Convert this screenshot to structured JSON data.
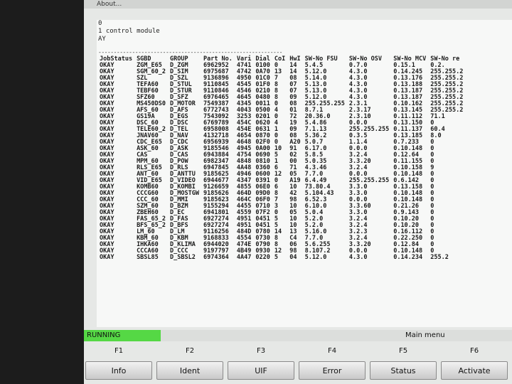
{
  "window": {
    "title": "About..."
  },
  "header": {
    "lines": [
      "0",
      "1 control module",
      "AY"
    ]
  },
  "separator": "------------------------------------------------------------",
  "table": {
    "columns": [
      "JobStatus",
      "SGBD",
      "GROUP",
      "Part No.",
      "Vari",
      "Dial",
      "CoI",
      "HwI",
      "SW-No FSU",
      "SW-No OSV",
      "SW-No MCV",
      "SW-No re"
    ],
    "rows": [
      [
        "OKAY",
        "ZGM_E65",
        "D_ZGM",
        "6962952",
        "4741",
        "0100",
        "0",
        "14",
        "5.4.5",
        "0.7.0",
        "0.15.1",
        "0.2."
      ],
      [
        "OKAY",
        "SGM_60_2",
        "D_SIM",
        "6975687",
        "4742",
        "0A70",
        "13",
        "14",
        "5.12.0",
        "4.3.0",
        "0.14.245",
        "255.255.2"
      ],
      [
        "OKAY",
        "SZL",
        "D_SZL",
        "9136896",
        "4950",
        "01C0",
        "7",
        "08",
        "5.14.0",
        "4.3.0",
        "0.13.176",
        "255.255.2"
      ],
      [
        "OKAY",
        "TEFA60",
        "D_STUL",
        "9110845",
        "4545",
        "01F0",
        "8",
        "07",
        "5.13.0",
        "4.3.0",
        "0.13.188",
        "255.255.2"
      ],
      [
        "OKAY",
        "TEBF60",
        "D_STUR",
        "9110846",
        "4546",
        "0210",
        "8",
        "07",
        "5.13.0",
        "4.3.0",
        "0.13.187",
        "255.255.2"
      ],
      [
        "OKAY",
        "SFZ60",
        "D_SFZ",
        "6976465",
        "4645",
        "0480",
        "8",
        "09",
        "5.12.0",
        "4.3.0",
        "0.13.187",
        "255.255.2"
      ],
      [
        "OKAY",
        "MS450DS0",
        "D_MOTOR",
        "7549387",
        "4345",
        "0011",
        "0",
        "08",
        "255.255.255",
        "2.3.1",
        "0.10.162",
        "255.255.2"
      ],
      [
        "OKAY",
        "AFS_60",
        "D_AFS",
        "6772743",
        "4043",
        "0500",
        "4",
        "01",
        "8.7.1",
        "2.3.17",
        "0.13.145",
        "255.255.2"
      ],
      [
        "OKAY",
        "GS19A",
        "D_EGS",
        "7543092",
        "3253",
        "0201",
        "0",
        "72",
        "20.36.0",
        "2.3.10",
        "0.11.112",
        "71.1"
      ],
      [
        "OKAY",
        "DSC_60",
        "D_DSC",
        "6769789",
        "454C",
        "0620",
        "4",
        "19",
        "5.4.86",
        "0.0.0",
        "0.13.150",
        "0"
      ],
      [
        "OKAY",
        "TELE60_2",
        "D_TEL",
        "6958008",
        "454E",
        "0631",
        "1",
        "09",
        "7.1.13",
        "255.255.255",
        "0.11.137",
        "60.4"
      ],
      [
        "OKAY",
        "JNAV60",
        "D_NAV",
        "4132718",
        "4654",
        "0870",
        "0",
        "08",
        "5.36.2",
        "0.3.5",
        "0.13.185",
        "8.0"
      ],
      [
        "OKAY",
        "CDC_E65",
        "D_CDC",
        "6956939",
        "4648",
        "02F0",
        "0",
        "A20",
        "5.0.7",
        "1.1.4",
        "0.7.233",
        "0"
      ],
      [
        "OKAY",
        "ASK_60",
        "D_ASK",
        "9185546",
        "4945",
        "0A00",
        "10",
        "91",
        "6.17.0",
        "0.0.0",
        "0.10.148",
        "0"
      ],
      [
        "OKAY",
        "CAS",
        "D_CAS",
        "6943884",
        "4754",
        "0690",
        "5",
        "02",
        "5.8.5",
        "3.2.4",
        "0.12.64",
        "0"
      ],
      [
        "OKAY",
        "MPM_60",
        "D_POW",
        "6982347",
        "4848",
        "0810",
        "1",
        "00",
        "5.0.35",
        "3.3.20",
        "0.11.155",
        "0"
      ],
      [
        "OKAY",
        "RLS_E65",
        "D_RLS",
        "6947845",
        "4A48",
        "0360",
        "6",
        "71",
        "4.3.46",
        "3.2.4",
        "0.10.158",
        "9"
      ],
      [
        "OKAY",
        "ANT_60",
        "D_ANTTU",
        "9185625",
        "4946",
        "0600",
        "12",
        "05",
        "7.7.0",
        "0.0.0",
        "0.10.148",
        "0"
      ],
      [
        "OKAY",
        "VID_E65",
        "D_VIDEO",
        "6944677",
        "4347",
        "0391",
        "0",
        "A19",
        "6.4.49",
        "255.255.255",
        "0.6.142",
        "0"
      ],
      [
        "OKAY",
        "KOMB60",
        "D_KOMBI",
        "9126659",
        "4855",
        "06E0",
        "6",
        "10",
        "73.80.4",
        "3.3.0",
        "0.13.158",
        "0"
      ],
      [
        "OKAY",
        "CCCG60",
        "D_MOSTGW",
        "9185626",
        "464D",
        "09D0",
        "8",
        "42",
        "5.104.43",
        "3.3.0",
        "0.10.148",
        "0"
      ],
      [
        "OKAY",
        "CCC_60",
        "D_MMI",
        "9185623",
        "464C",
        "06F0",
        "7",
        "98",
        "6.52.3",
        "0.0.0",
        "0.10.148",
        "0"
      ],
      [
        "OKAY",
        "SZM_60",
        "D_BZM",
        "9155294",
        "4455",
        "0710",
        "3",
        "10",
        "6.10.0",
        "3.3.60",
        "0.21.26",
        "0"
      ],
      [
        "OKAY",
        "ZBEH60",
        "D_EC",
        "6941801",
        "4559",
        "07F2",
        "0",
        "05",
        "5.0.4",
        "3.3.0",
        "0.9.143",
        "0"
      ],
      [
        "OKAY",
        "FAS_65_2",
        "D_FAS",
        "6927274",
        "4951",
        "0451",
        "5",
        "10",
        "5.2.0",
        "3.2.4",
        "0.10.20",
        "0"
      ],
      [
        "OKAY",
        "BFS_65_2",
        "D_BFS",
        "6927274",
        "4951",
        "0451",
        "5",
        "10",
        "5.2.0",
        "3.2.4",
        "0.10.20",
        "0"
      ],
      [
        "OKAY",
        "LM_60",
        "D_LM",
        "9116256",
        "484D",
        "0780",
        "14",
        "13",
        "5.16.0",
        "3.2.3",
        "0.16.112",
        "0"
      ],
      [
        "OKAY",
        "KBM_60",
        "D_KBM",
        "9168833",
        "4554",
        "0730",
        "8",
        "C4",
        "7.7.0",
        "3.2.4",
        "0.22.250",
        "0"
      ],
      [
        "OKAY",
        "IHKA60",
        "D_KLIMA",
        "6944020",
        "474E",
        "0790",
        "8",
        "06",
        "5.6.255",
        "3.3.20",
        "0.12.84",
        "0"
      ],
      [
        "OKAY",
        "CCCA60",
        "D_CCC",
        "9197797",
        "4B49",
        "0930",
        "12",
        "98",
        "8.107.2",
        "0.0.0",
        "0.10.148",
        "0"
      ],
      [
        "OKAY",
        "SBSL85",
        "D_SBSL2",
        "6974364",
        "4A47",
        "0220",
        "5",
        "04",
        "5.12.0",
        "4.3.0",
        "0.14.234",
        "255.2"
      ]
    ]
  },
  "statusbar": {
    "state": "RUNNING",
    "menu": "Main menu"
  },
  "function_keys": [
    {
      "key": "F1",
      "label": "Info"
    },
    {
      "key": "F2",
      "label": "Ident"
    },
    {
      "key": "F3",
      "label": "UIF"
    },
    {
      "key": "F4",
      "label": "Error"
    },
    {
      "key": "F5",
      "label": "Status"
    },
    {
      "key": "F6",
      "label": "Activate"
    }
  ]
}
